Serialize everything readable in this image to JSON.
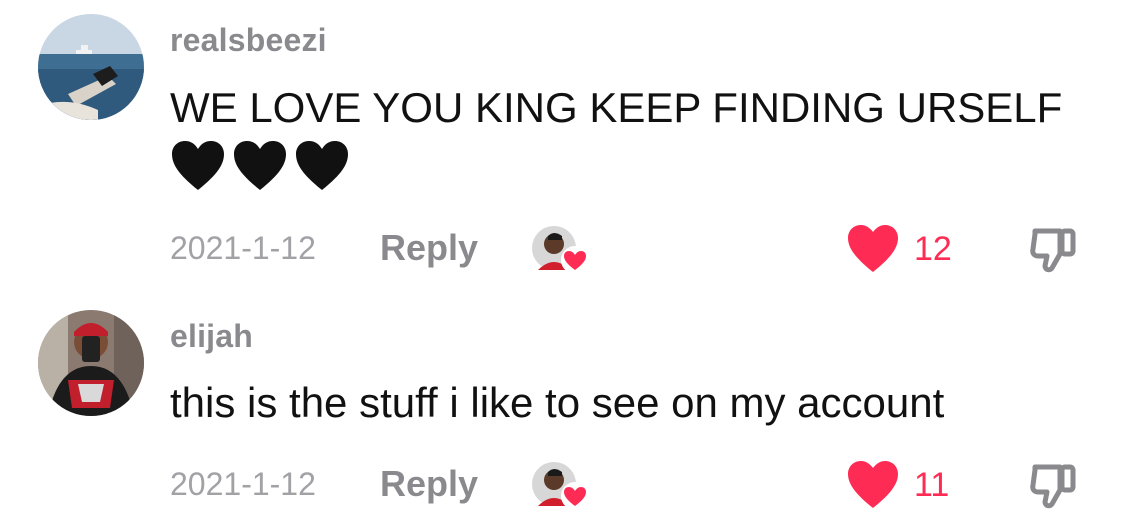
{
  "colors": {
    "username": "#8a8a8e",
    "date": "#a1a1a6",
    "reply": "#8a8a8e",
    "like_red": "#fe2c55",
    "text": "#111111"
  },
  "comments": [
    {
      "username": "realsbeezi",
      "text": "WE LOVE YOU KING KEEP FINDING URSELF",
      "emoji": [
        "🖤",
        "🖤",
        "🖤"
      ],
      "date": "2021-1-12",
      "reply_label": "Reply",
      "like_count": "12",
      "avatar_icon": "boat-on-water-avatar",
      "creator_liked": true
    },
    {
      "username": "elijah",
      "text": "this is the stuff i like to see on my account",
      "date": "2021-1-12",
      "reply_label": "Reply",
      "like_count": "11",
      "avatar_icon": "mirror-selfie-avatar",
      "creator_liked": true
    }
  ]
}
